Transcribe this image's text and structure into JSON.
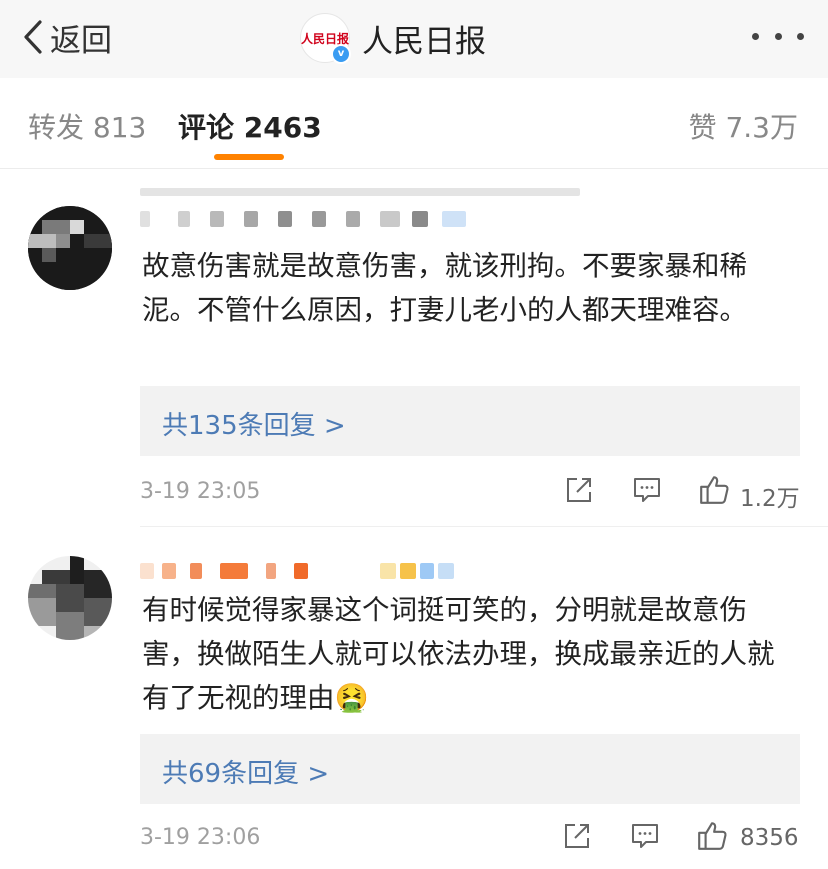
{
  "header": {
    "back_label": "返回",
    "account_name": "人民日报",
    "logo_text": "人民日报",
    "verified_icon": "verified-badge-icon"
  },
  "tabs": [
    {
      "label": "转发 813",
      "active": false
    },
    {
      "label": "评论 2463",
      "active": true
    },
    {
      "label": "赞 7.3万",
      "active": false
    }
  ],
  "comments": [
    {
      "text": "故意伤害就是故意伤害，就该刑拘。不要家暴和稀泥。不管什么原因，打妻儿老小的人都天理难容。",
      "replies_label": "共135条回复 >",
      "time": "3-19 23:05",
      "likes": "1.2万"
    },
    {
      "text": "有时候觉得家暴这个词挺可笑的，分明就是故意伤害，换做陌生人就可以依法办理，换成最亲近的人就有了无视的理由🤮",
      "replies_label": "共69条回复 >",
      "time": "3-19 23:06",
      "likes": "8356"
    }
  ],
  "colors": {
    "accent_orange": "#ff8200",
    "link_blue": "#4d7bb5",
    "reply_bg": "#f2f2f2",
    "header_bg": "#f7f7f7"
  }
}
